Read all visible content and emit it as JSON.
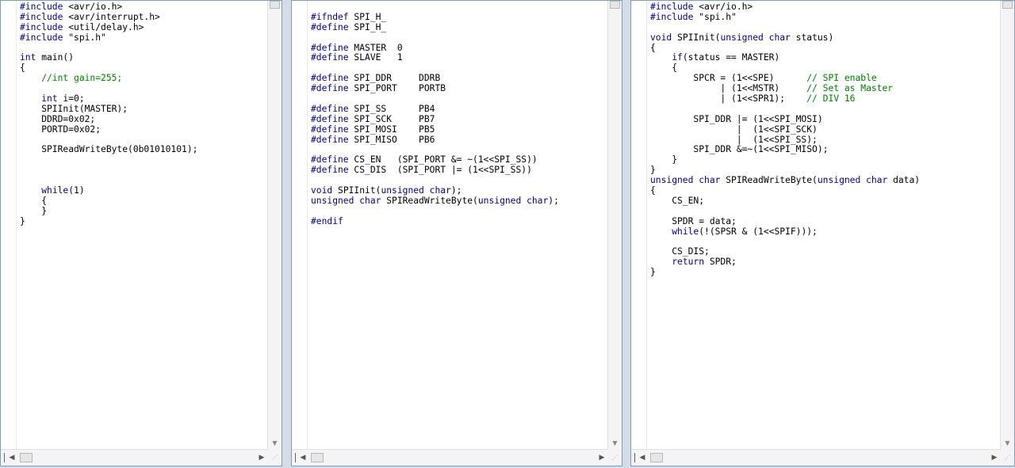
{
  "panes": [
    {
      "name": "main-c",
      "lines": [
        [
          [
            "#include ",
            "kw"
          ],
          [
            "<avr/io.h>",
            "pl"
          ]
        ],
        [
          [
            "#include ",
            "kw"
          ],
          [
            "<avr/interrupt.h>",
            "pl"
          ]
        ],
        [
          [
            "#include ",
            "kw"
          ],
          [
            "<util/delay.h>",
            "pl"
          ]
        ],
        [
          [
            "#include ",
            "kw"
          ],
          [
            "\"spi.h\"",
            "pl"
          ]
        ],
        [],
        [
          [
            "int",
            "kw"
          ],
          [
            " main()",
            "pl"
          ]
        ],
        [
          [
            "{",
            "pl"
          ]
        ],
        [
          [
            "    //int gain=255;",
            "cm"
          ]
        ],
        [],
        [
          [
            "    ",
            "pl"
          ],
          [
            "int",
            "kw"
          ],
          [
            " i=0;",
            "pl"
          ]
        ],
        [
          [
            "    SPIInit(MASTER);",
            "pl"
          ]
        ],
        [
          [
            "    DDRD=0x02;",
            "pl"
          ]
        ],
        [
          [
            "    PORTD=0x02;",
            "pl"
          ]
        ],
        [],
        [
          [
            "    SPIReadWriteByte(0b01010101);",
            "pl"
          ]
        ],
        [],
        [],
        [],
        [
          [
            "    ",
            "pl"
          ],
          [
            "while",
            "kw"
          ],
          [
            "(1)",
            "pl"
          ]
        ],
        [
          [
            "    {",
            "pl"
          ]
        ],
        [
          [
            "    }",
            "pl"
          ]
        ],
        [
          [
            "}",
            "pl"
          ]
        ]
      ]
    },
    {
      "name": "spi-h",
      "lines": [
        [],
        [
          [
            "#ifndef ",
            "kw"
          ],
          [
            "SPI_H_",
            "pl"
          ]
        ],
        [
          [
            "#define ",
            "kw"
          ],
          [
            "SPI_H_",
            "pl"
          ]
        ],
        [],
        [
          [
            "#define ",
            "kw"
          ],
          [
            "MASTER  0",
            "pl"
          ]
        ],
        [
          [
            "#define ",
            "kw"
          ],
          [
            "SLAVE   1",
            "pl"
          ]
        ],
        [],
        [
          [
            "#define ",
            "kw"
          ],
          [
            "SPI_DDR     DDRB",
            "pl"
          ]
        ],
        [
          [
            "#define ",
            "kw"
          ],
          [
            "SPI_PORT    PORTB",
            "pl"
          ]
        ],
        [],
        [
          [
            "#define ",
            "kw"
          ],
          [
            "SPI_SS      PB4",
            "pl"
          ]
        ],
        [
          [
            "#define ",
            "kw"
          ],
          [
            "SPI_SCK     PB7",
            "pl"
          ]
        ],
        [
          [
            "#define ",
            "kw"
          ],
          [
            "SPI_MOSI    PB5",
            "pl"
          ]
        ],
        [
          [
            "#define ",
            "kw"
          ],
          [
            "SPI_MISO    PB6",
            "pl"
          ]
        ],
        [],
        [
          [
            "#define ",
            "kw"
          ],
          [
            "CS_EN   (SPI_PORT &= ~(1<<SPI_SS))",
            "pl"
          ]
        ],
        [
          [
            "#define ",
            "kw"
          ],
          [
            "CS_DIS  (SPI_PORT |= (1<<SPI_SS))",
            "pl"
          ]
        ],
        [],
        [
          [
            "void",
            "kw"
          ],
          [
            " SPIInit(",
            "pl"
          ],
          [
            "unsigned char",
            "kw"
          ],
          [
            ");",
            "pl"
          ]
        ],
        [
          [
            "unsigned char",
            "kw"
          ],
          [
            " SPIReadWriteByte(",
            "pl"
          ],
          [
            "unsigned char",
            "kw"
          ],
          [
            ");",
            "pl"
          ]
        ],
        [],
        [
          [
            "#endif",
            "kw"
          ]
        ]
      ]
    },
    {
      "name": "spi-c",
      "lines": [
        [
          [
            "#include ",
            "kw"
          ],
          [
            "<avr/io.h>",
            "pl"
          ]
        ],
        [
          [
            "#include ",
            "kw"
          ],
          [
            "\"spi.h\"",
            "pl"
          ]
        ],
        [],
        [
          [
            "void",
            "kw"
          ],
          [
            " SPIInit(",
            "pl"
          ],
          [
            "unsigned char",
            "kw"
          ],
          [
            " status)",
            "pl"
          ]
        ],
        [
          [
            "{",
            "pl"
          ]
        ],
        [
          [
            "    ",
            "pl"
          ],
          [
            "if",
            "kw"
          ],
          [
            "(status == MASTER)",
            "pl"
          ]
        ],
        [
          [
            "    {",
            "pl"
          ]
        ],
        [
          [
            "        SPCR = (1<<SPE)      ",
            "pl"
          ],
          [
            "// SPI enable",
            "cm"
          ]
        ],
        [
          [
            "             | (1<<MSTR)     ",
            "pl"
          ],
          [
            "// Set as Master",
            "cm"
          ]
        ],
        [
          [
            "             | (1<<SPR1);    ",
            "pl"
          ],
          [
            "// DIV 16",
            "cm"
          ]
        ],
        [],
        [
          [
            "        SPI_DDR |= (1<<SPI_MOSI)",
            "pl"
          ]
        ],
        [
          [
            "                |  (1<<SPI_SCK)",
            "pl"
          ]
        ],
        [
          [
            "                |  (1<<SPI_SS);",
            "pl"
          ]
        ],
        [
          [
            "        SPI_DDR &=~(1<<SPI_MISO);",
            "pl"
          ]
        ],
        [
          [
            "    }",
            "pl"
          ]
        ],
        [
          [
            "}",
            "pl"
          ]
        ],
        [
          [
            "unsigned char",
            "kw"
          ],
          [
            " SPIReadWriteByte(",
            "pl"
          ],
          [
            "unsigned char",
            "kw"
          ],
          [
            " data)",
            "pl"
          ]
        ],
        [
          [
            "{",
            "pl"
          ]
        ],
        [
          [
            "    CS_EN;",
            "pl"
          ]
        ],
        [],
        [
          [
            "    SPDR = data;",
            "pl"
          ]
        ],
        [
          [
            "    ",
            "pl"
          ],
          [
            "while",
            "kw"
          ],
          [
            "(!(SPSR & (1<<SPIF)));",
            "pl"
          ]
        ],
        [],
        [
          [
            "    CS_DIS;",
            "pl"
          ]
        ],
        [
          [
            "    ",
            "pl"
          ],
          [
            "return",
            "kw"
          ],
          [
            " SPDR;",
            "pl"
          ]
        ],
        [
          [
            "}",
            "pl"
          ]
        ]
      ]
    }
  ],
  "colors": {
    "keyword": "#00008b",
    "comment": "#008000",
    "plain": "#000000",
    "background": "#ffffff",
    "window_bg": "#d4dce8"
  },
  "icons": {
    "scroll_up": "▲",
    "scroll_down": "▼",
    "scroll_left": "◀",
    "scroll_right": "▶",
    "resize_grip": "⋰"
  }
}
